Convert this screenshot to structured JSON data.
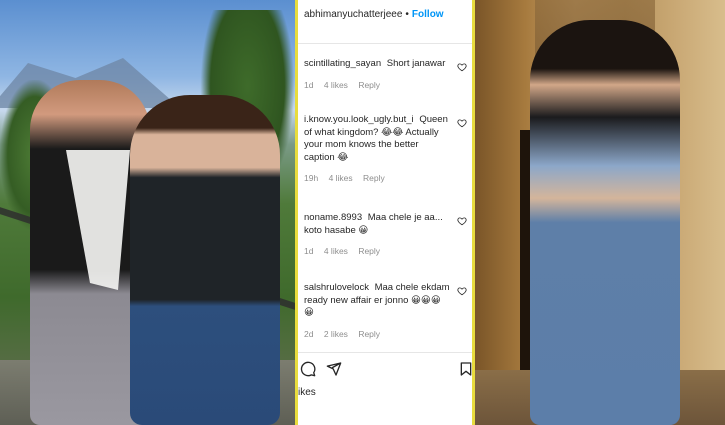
{
  "header": {
    "username": "abhimanyuchatterjeee",
    "separator": "•",
    "follow_label": "Follow"
  },
  "comments": [
    {
      "user": "scintillating_sayan",
      "text": "Short janawar",
      "age": "1d",
      "likes": "4 likes",
      "reply": "Reply"
    },
    {
      "user": "i.know.you.look_ugly.but_i",
      "text": "Queen of what kingdom? 😂😂 Actually your mom knows the better caption 😂",
      "age": "19h",
      "likes": "4 likes",
      "reply": "Reply"
    },
    {
      "user": "noname.8993",
      "text": "Maa chele je aa... koto hasabe 😀",
      "age": "1d",
      "likes": "4 likes",
      "reply": "Reply"
    },
    {
      "user": "salshrulovelock",
      "text": "Maa chele ekdam ready new affair er jonno 😀😀😀😀",
      "age": "2d",
      "likes": "2 likes",
      "reply": "Reply"
    }
  ],
  "footer": {
    "likes_text": "ikes"
  },
  "icons": {
    "heart": "heart-icon",
    "comment": "comment-icon",
    "share": "share-icon",
    "bookmark": "bookmark-icon"
  },
  "colors": {
    "follow": "#0095f6",
    "border_accent": "#e8dc3e",
    "meta_text": "#8e8e8e"
  }
}
